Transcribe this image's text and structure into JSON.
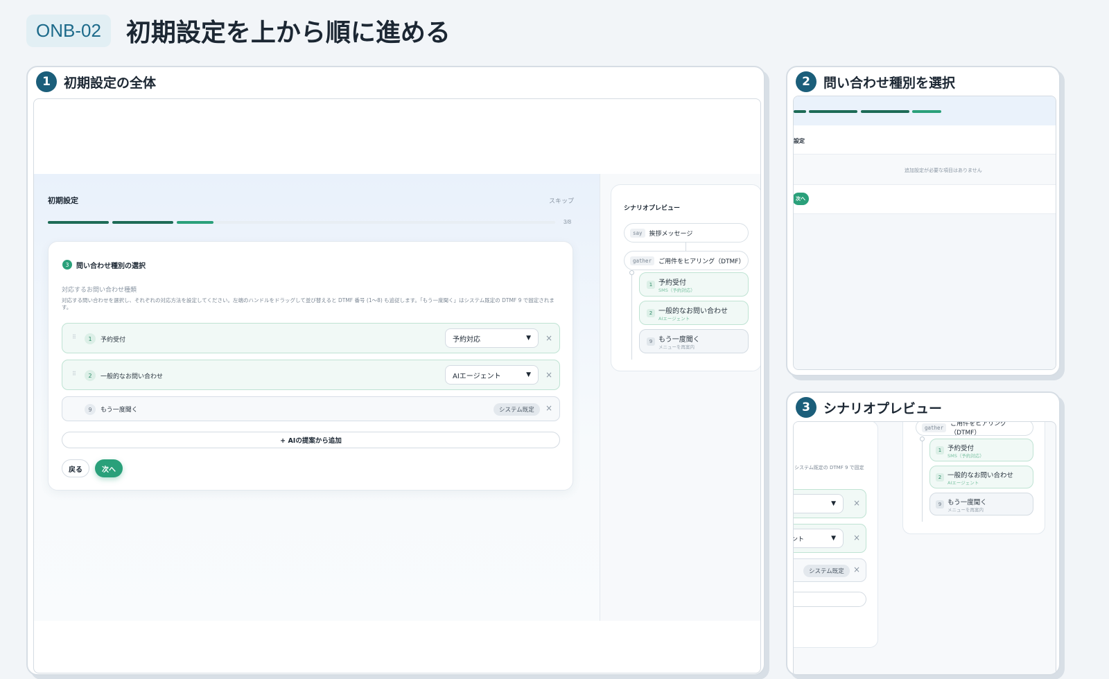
{
  "header": {
    "code": "ONB-02",
    "title": "初期設定を上から順に進める"
  },
  "panels": [
    {
      "num": "1",
      "title": "初期設定の全体"
    },
    {
      "num": "2",
      "title": "問い合わせ種別を選択"
    },
    {
      "num": "3",
      "title": "シナリオプレビュー"
    }
  ],
  "app": {
    "heading": "初期設定",
    "skip": "スキップ",
    "progress_text": "3/8",
    "progress_steps": 8,
    "progress_current": 3,
    "step_num": "3",
    "step_title": "問い合わせ種別の選択",
    "section_label": "対応するお問い合わせ種類",
    "help": "対応する問い合わせを選択し、それぞれの対応方法を設定してください。左端のハンドルをドラッグして並び替えると DTMF 番号 (1〜8) も追従します。「もう一度聞く」はシステム既定の DTMF 9 で固定されます。",
    "rows": [
      {
        "num": "1",
        "name": "予約受付",
        "select": "予約対応"
      },
      {
        "num": "2",
        "name": "一般的なお問い合わせ",
        "select": "AIエージェント"
      },
      {
        "num": "9",
        "name": "もう一度聞く",
        "badge": "システム既定"
      }
    ],
    "add_button": "+ AIの提案から追加",
    "back": "戻る",
    "next": "次へ"
  },
  "preview": {
    "title": "シナリオプレビュー",
    "say_tag": "say",
    "say_text": "挨拶メッセージ",
    "gather_tag": "gather",
    "gather_text": "ご用件をヒアリング（DTMF）",
    "items": [
      {
        "num": "1",
        "title": "予約受付",
        "desc": "SMS（予約対応）"
      },
      {
        "num": "2",
        "title": "一般的なお問い合わせ",
        "desc": "AIエージェント"
      },
      {
        "num": "9",
        "title": "もう一度聞く",
        "desc": "メニューを再案内"
      }
    ]
  },
  "zoom2": {
    "heading": "設定",
    "empty": "追加設定が必要な項目はありません",
    "next": "次へ"
  },
  "zoom3": {
    "help_tail": "システム既定の DTMF 9 で固定",
    "select_tail": "ント",
    "badge": "システム既定"
  },
  "colors": {
    "accent": "#2aa07a",
    "progress_done": "#1d6b56",
    "badge_bg": "#1b5e7a"
  }
}
